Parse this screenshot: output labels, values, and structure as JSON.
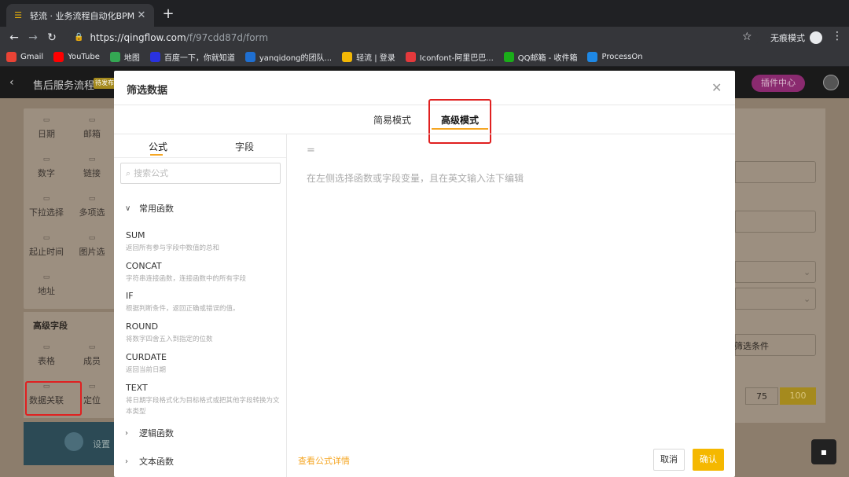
{
  "browser": {
    "tab_title": "轻流 · 业务流程自动化BPM",
    "url_prefix": "https://",
    "url_host": "qingflow.com",
    "url_path": "/f/97cdd87d/form",
    "incognito_label": "无痕模式",
    "bookmarks": [
      {
        "label": "Gmail",
        "icon": "gmail-icon",
        "color": "#ea4335"
      },
      {
        "label": "YouTube",
        "icon": "youtube-icon",
        "color": "#ff0000"
      },
      {
        "label": "地图",
        "icon": "maps-icon",
        "color": "#34a853"
      },
      {
        "label": "百度一下，你就知道",
        "icon": "baidu-icon",
        "color": "#2932e1"
      },
      {
        "label": "yanqidong的团队...",
        "icon": "team-icon",
        "color": "#1f6fd1"
      },
      {
        "label": "轻流 | 登录",
        "icon": "qingflow-icon",
        "color": "#f2b705"
      },
      {
        "label": "Iconfont-阿里巴巴...",
        "icon": "iconfont-icon",
        "color": "#e4393c"
      },
      {
        "label": "QQ邮箱 - 收件箱",
        "icon": "qqmail-icon",
        "color": "#1aad19"
      },
      {
        "label": "ProcessOn",
        "icon": "processon-icon",
        "color": "#1e88e5"
      }
    ]
  },
  "app": {
    "title": "售后服务流程",
    "badge": "待发布",
    "plugin_center": "插件中心",
    "basic_fields": [
      "日期",
      "邮箱",
      "数字",
      "链接",
      "下拉选择",
      "多项选",
      "起止时间",
      "图片选",
      "地址"
    ],
    "advanced_title": "高级字段",
    "advanced_fields": [
      "表格",
      "成员",
      "数据关联",
      "定位"
    ],
    "promo_label": "设置",
    "filter_condition": "筛选条件",
    "segments": [
      "75",
      "100"
    ]
  },
  "modal": {
    "title": "筛选数据",
    "tabs": [
      "简易模式",
      "高级模式"
    ],
    "active_tab": "高级模式",
    "side_tabs": [
      "公式",
      "字段"
    ],
    "search_placeholder": "搜索公式",
    "groups": {
      "common": "常用函数",
      "logic": "逻辑函数",
      "text": "文本函数"
    },
    "functions": [
      {
        "name": "SUM",
        "desc": "返回所有参与字段中数值的总和"
      },
      {
        "name": "CONCAT",
        "desc": "字符串连接函数，连接函数中的所有字段"
      },
      {
        "name": "IF",
        "desc": "根据判断条件，返回正确或错误的值。"
      },
      {
        "name": "ROUND",
        "desc": "将数字四舍五入到指定的位数"
      },
      {
        "name": "CURDATE",
        "desc": "返回当前日期"
      },
      {
        "name": "TEXT",
        "desc": "将日期字段格式化为目标格式或把其他字段转换为文本类型"
      }
    ],
    "editor_eq": "=",
    "editor_hint": "在左侧选择函数或字段变量，且在英文输入法下编辑",
    "formula_link": "查看公式详情",
    "cancel": "取消",
    "confirm": "确认"
  }
}
